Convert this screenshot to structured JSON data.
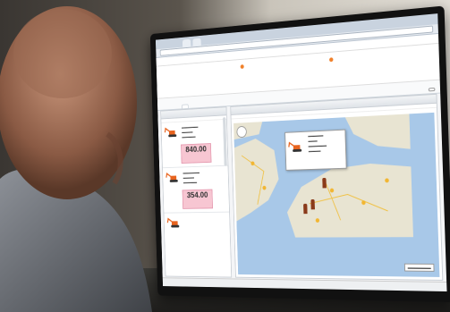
{
  "app": {
    "header_title": "",
    "user": ""
  },
  "info": {
    "field1_label": "",
    "field2_label": "",
    "field3_label": ""
  },
  "tabs": [
    {
      "label": ""
    },
    {
      "label": ""
    },
    {
      "label": ""
    },
    {
      "label": ""
    },
    {
      "label": ""
    }
  ],
  "print_label": "",
  "left_panel": {
    "title": "",
    "subtitle": "",
    "machines": [
      {
        "price_caption": "",
        "price": "840.00"
      },
      {
        "price_caption": "",
        "price": "354.00"
      },
      {
        "price_caption": "",
        "price": ""
      }
    ]
  },
  "right_panel": {
    "title": "",
    "subtitle": ""
  },
  "status": "",
  "colors": {
    "accent": "#f0802a",
    "price_bg": "#f7c6d2",
    "map_water": "#a8c8e8",
    "map_land": "#e8e4d2"
  }
}
